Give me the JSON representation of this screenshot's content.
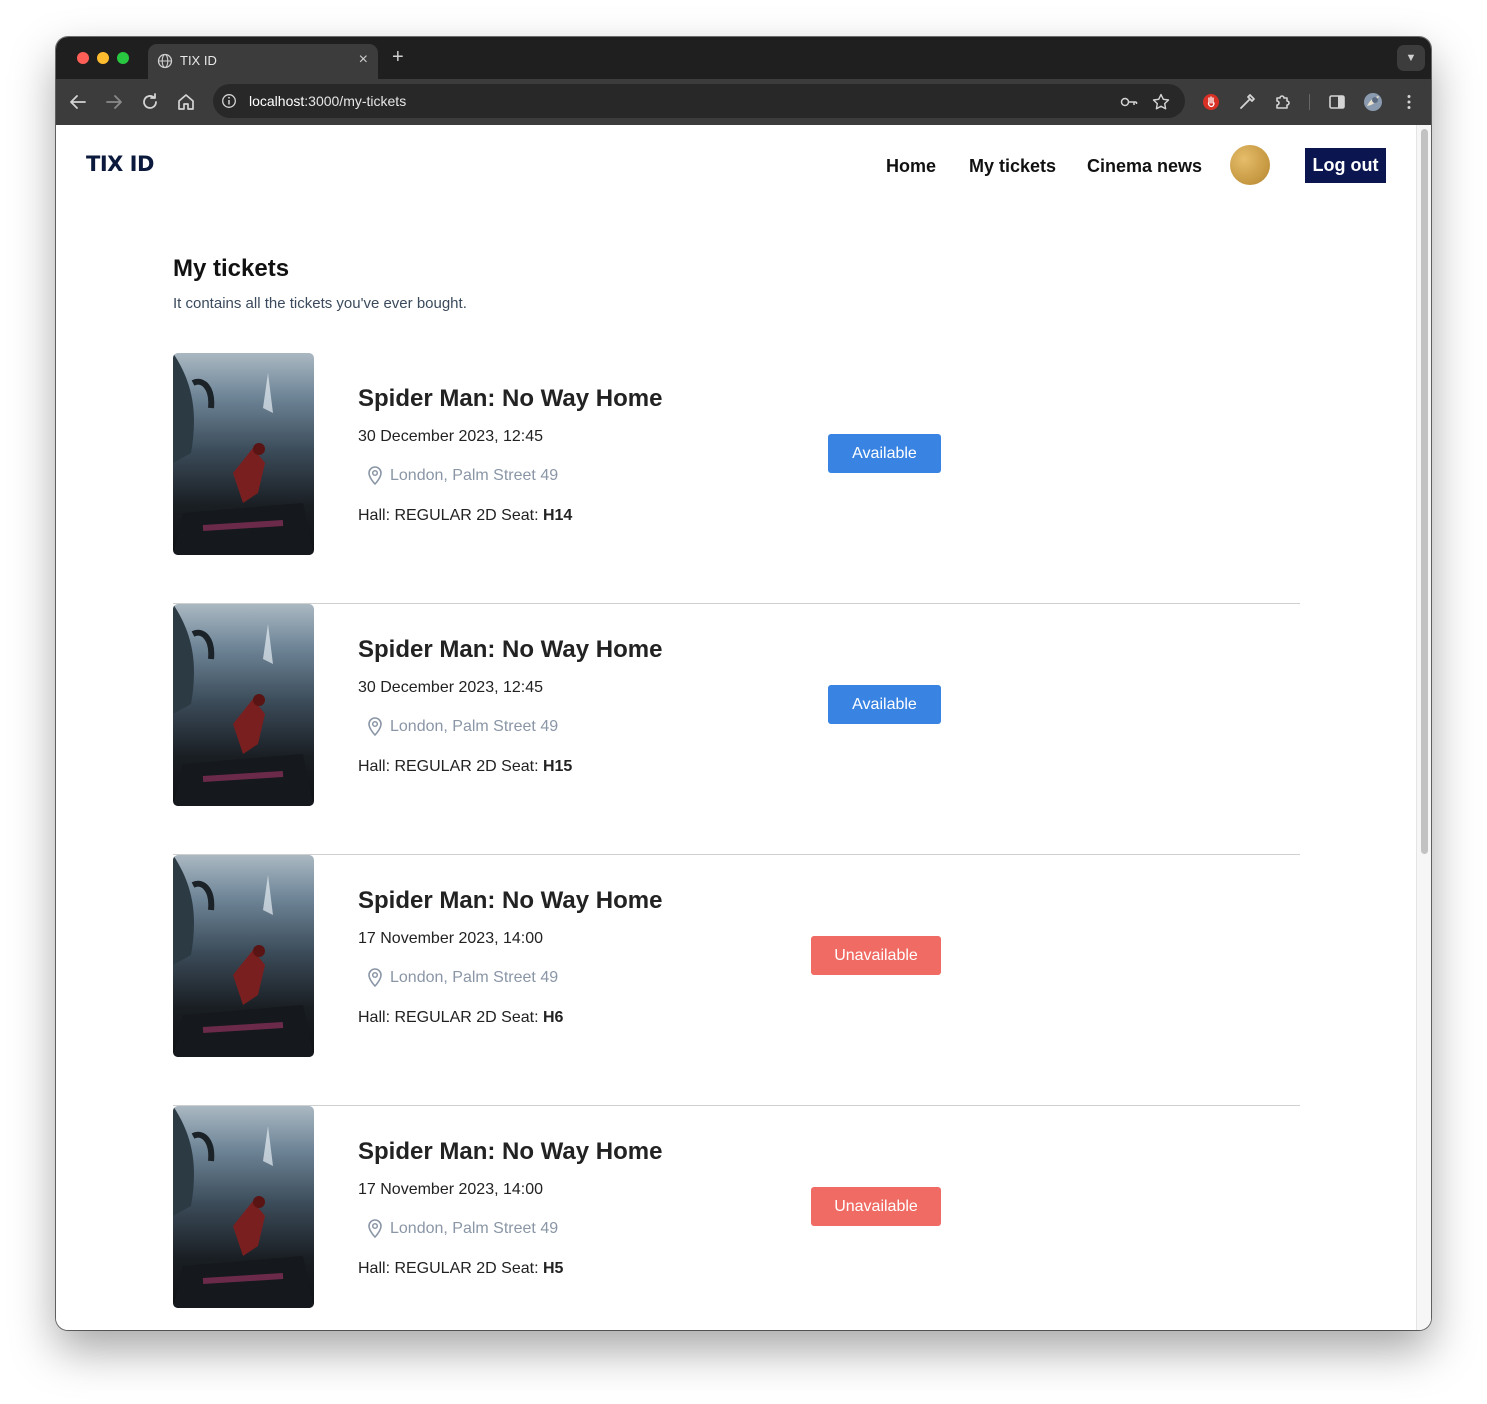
{
  "browser": {
    "tab_title": "TIX ID",
    "new_tab_label": "+",
    "close_tab_label": "×",
    "url_host": "localhost",
    "url_rest": ":3000/my-tickets"
  },
  "site": {
    "logo": "TIX ID",
    "nav": [
      "Home",
      "My tickets",
      "Cinema news"
    ],
    "logout_label": "Log out"
  },
  "page": {
    "title": "My tickets",
    "subtitle": "It contains all the tickets you've ever bought."
  },
  "tickets": [
    {
      "title": "Spider Man: No Way Home",
      "datetime": "30 December 2023, 12:45",
      "location": "London, Palm Street 49",
      "hall_prefix": "Hall: REGULAR 2D Seat: ",
      "seat": "H14",
      "status": "Available"
    },
    {
      "title": "Spider Man: No Way Home",
      "datetime": "30 December 2023, 12:45",
      "location": "London, Palm Street 49",
      "hall_prefix": "Hall: REGULAR 2D Seat: ",
      "seat": "H15",
      "status": "Available"
    },
    {
      "title": "Spider Man: No Way Home",
      "datetime": "17 November 2023, 14:00",
      "location": "London, Palm Street 49",
      "hall_prefix": "Hall: REGULAR 2D Seat: ",
      "seat": "H6",
      "status": "Unavailable"
    },
    {
      "title": "Spider Man: No Way Home",
      "datetime": "17 November 2023, 14:00",
      "location": "London, Palm Street 49",
      "hall_prefix": "Hall: REGULAR 2D Seat: ",
      "seat": "H5",
      "status": "Unavailable"
    }
  ],
  "colors": {
    "available": "#3984e2",
    "unavailable": "#ef6b63",
    "logout_bg": "#0b1650",
    "logo": "#0b1a3c"
  },
  "icons": [
    "globe-icon",
    "back-icon",
    "forward-icon",
    "reload-icon",
    "home-icon",
    "site-info-icon",
    "key-icon",
    "star-icon",
    "extension-icon",
    "eyedropper-icon",
    "puzzle-icon",
    "sidebar-icon",
    "profile-icon",
    "menu-icon",
    "location-pin-icon"
  ]
}
